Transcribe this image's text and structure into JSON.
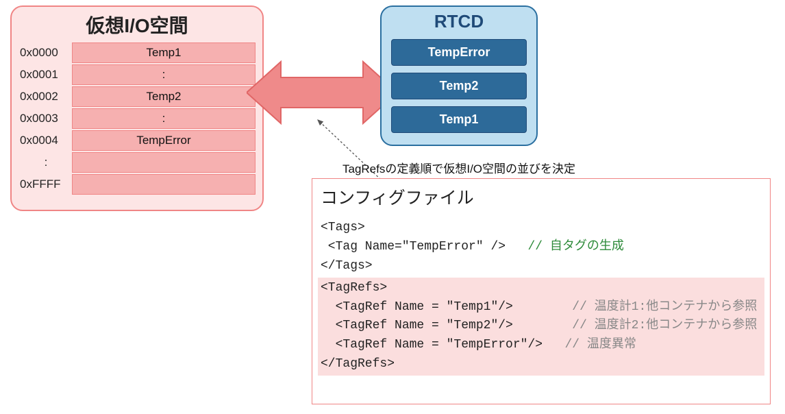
{
  "vio": {
    "title": "仮想I/O空間",
    "rows": [
      {
        "addr": "0x0000",
        "label": "Temp1"
      },
      {
        "addr": "0x0001",
        "label": ":"
      },
      {
        "addr": "0x0002",
        "label": "Temp2"
      },
      {
        "addr": "0x0003",
        "label": ":"
      },
      {
        "addr": "0x0004",
        "label": "TempError"
      },
      {
        "addr": ":",
        "label": ""
      },
      {
        "addr": "0xFFFF",
        "label": ""
      }
    ]
  },
  "rtcd": {
    "title": "RTCD",
    "items": [
      "TempError",
      "Temp2",
      "Temp1"
    ]
  },
  "caption": "TagRefsの定義順で仮想I/O空間の並びを決定",
  "config": {
    "title": "コンフィグファイル",
    "tags_open": "<Tags>",
    "tag_line": " <Tag Name=\"TempError\" />",
    "tag_comment": "   // 自タグの生成",
    "tags_close": "</Tags>",
    "tagrefs_open": "<TagRefs>",
    "ref1": "  <TagRef Name = \"Temp1\"/>",
    "ref1_comment": "        // 温度計1:他コンテナから参照",
    "ref2": "  <TagRef Name = \"Temp2\"/>",
    "ref2_comment": "        // 温度計2:他コンテナから参照",
    "ref3": "  <TagRef Name = \"TempError\"/>",
    "ref3_comment": "   // 温度異常",
    "tagrefs_close": "</TagRefs>"
  },
  "colors": {
    "pink_bg": "#fde5e5",
    "pink_cell": "#f6b0b0",
    "pink_border": "#f08585",
    "blue_bg": "#bfdff1",
    "blue_item": "#2d6a99",
    "blue_border": "#1f4a78",
    "arrow_fill": "#ef8a8a"
  }
}
